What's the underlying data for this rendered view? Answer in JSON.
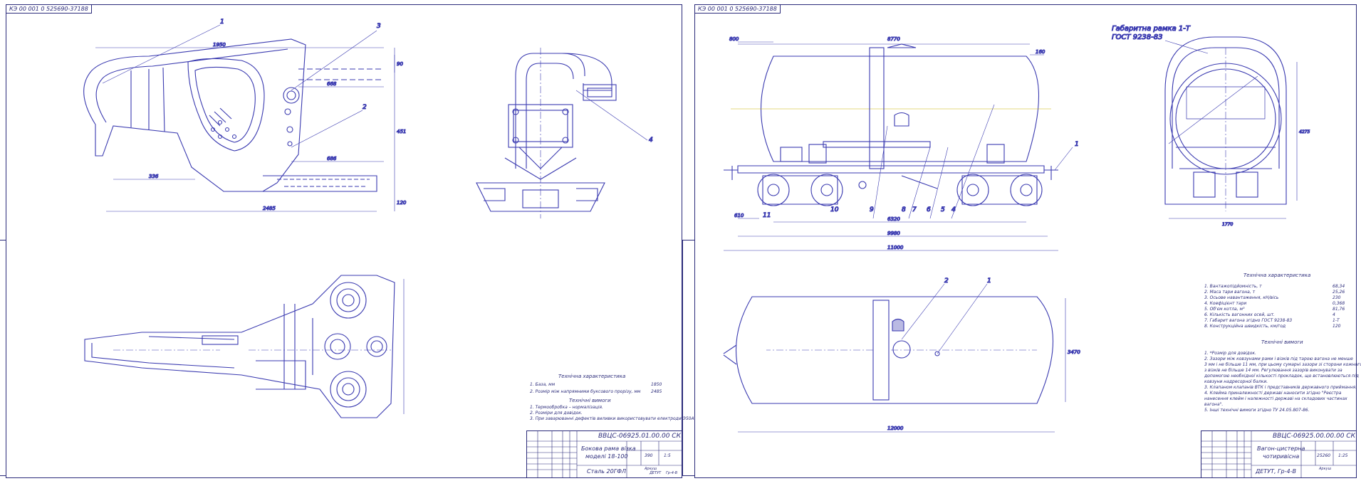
{
  "left_sheet": {
    "code": "КЭ 00 001 0 525690-37188",
    "dims": {
      "d1950": "1950",
      "d668": "668",
      "d686": "686",
      "d336": "336",
      "d2485": "2485",
      "d451": "451",
      "d120": "120",
      "d90": "90"
    },
    "callouts": {
      "c1": "1",
      "c2": "2",
      "c3": "3",
      "c4": "4"
    },
    "tech_chars": {
      "title": "Технічна характеристика",
      "rows": [
        {
          "label": "1. База, мм",
          "value": "1850"
        },
        {
          "label": "2. Розмір між напрямними буксового прорізу, мм",
          "value": "2485"
        }
      ]
    },
    "tech_reqs": {
      "title": "Технічні вимоги",
      "lines": [
        "1. Термообробка – нормалізація.",
        "2. Розміри для довідок.",
        "3. При заварюванні дефектів виливки використовувати електроди Э50А."
      ]
    },
    "title_block": {
      "code": "ВВЦС-06925.01.00.00 СК",
      "name_line1": "Бокова рама візка",
      "name_line2": "моделі 18-100",
      "material": "Сталь 20ГФЛ",
      "mass": "390",
      "scale": "1:5",
      "sheet_label": "Аркуш",
      "dept": "ДЕТУТ",
      "group": "Гр-4-В"
    }
  },
  "right_sheet": {
    "code": "КЭ 00 001 0 525690-37188",
    "gauge_label_line1": "Габаритна рамка 1-Т",
    "gauge_label_line2": "ГОСТ 9238-83",
    "dims": {
      "d800": "800",
      "d8770": "8770",
      "d160": "160",
      "d610": "610",
      "d6320": "6320",
      "d9980": "9980",
      "d11000": "11000",
      "d12000": "12000",
      "d3470": "3470",
      "d4275": "4275",
      "d1770": "1770"
    },
    "callouts": {
      "n1": "1",
      "n2": "2",
      "n4": "4",
      "n5": "5",
      "n6": "6",
      "n7": "7",
      "n8": "8",
      "n9": "9",
      "n10": "10",
      "n11": "11"
    },
    "tech_chars": {
      "title": "Технічна характеристика",
      "rows": [
        {
          "label": "1. Вантажопідйомність, т",
          "value": "68,34"
        },
        {
          "label": "2. Маса тари вагона, т",
          "value": "25,26"
        },
        {
          "label": "3. Осьове навантаження, кН/вісь",
          "value": "230"
        },
        {
          "label": "4. Коефіцієнт тари",
          "value": "0,368"
        },
        {
          "label": "5. Об'єм котла, м³",
          "value": "81,76"
        },
        {
          "label": "6. Кількість вагонних осей, шт.",
          "value": "4"
        },
        {
          "label": "7. Габарит вагона згідно ГОСТ 9238-83",
          "value": "1-Т"
        },
        {
          "label": "8. Конструкційна швидкість, км/год",
          "value": "120"
        }
      ]
    },
    "tech_reqs": {
      "title": "Технічні вимоги",
      "lines": [
        "1. *Розмір для довідок.",
        "2. Зазори між ковзунами рами і візків під тарою вагона не менше",
        "3 мм і не більше 11 мм, при цьому сумарні зазори зі сторони кожного",
        "з візків не більше 14 мм. Регулювання зазорів виконувати за",
        "допомогою необхідної кількості прокладок, що встановлюються під",
        "ковзуни надресорної балки.",
        "3. Клапаном клапанів ВТК і представників державного приймання.",
        "4. Клейма приналежності державі наносити згідно \"Реєстра",
        "нанесення клейм і належності державі на складових частинах",
        "вагона\".",
        "5. Інші технічні вимоги згідно ТУ 24.05.807-86."
      ]
    },
    "title_block": {
      "code": "ВВЦС-06925.00.00.00 СК",
      "name_line1": "Вагон-цистерна",
      "name_line2": "чотиривісна",
      "mass": "25260",
      "scale": "1:25",
      "sheet_label": "Аркуш",
      "dept": "ДЕТУТ, Гр-4-В"
    }
  }
}
